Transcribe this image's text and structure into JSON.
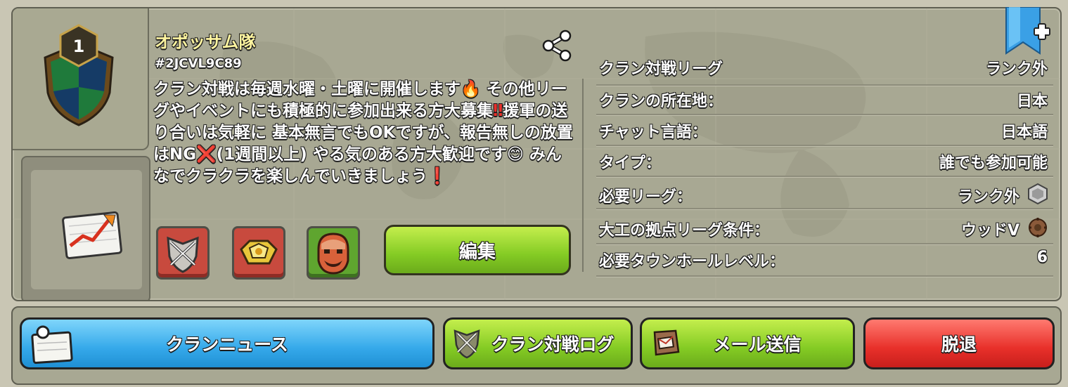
{
  "clan": {
    "name": "オポッサム隊",
    "tag": "#2JCVL9C89",
    "level": "1",
    "description": [
      {
        "text": "クラン対戦は毎週水曜・土曜に開催します",
        "emoji": "🔥"
      },
      {
        "text": " その他リーグやイベントにも積極的に参加出来る方大募集",
        "emoji": "‼"
      },
      {
        "text": "援軍の送り合いは気軽に 基本無言でもOKですが、報告無しの放置はNG",
        "emoji": "❌"
      },
      {
        "text": "(1週間以上) やる気のある方大歓迎です",
        "emoji": "😊"
      },
      {
        "text": " みんなでクラクラを楽しんでいきましょう",
        "emoji": "❗"
      }
    ]
  },
  "info_rows": [
    {
      "label": "クラン対戦リーグ",
      "value": "ランク外",
      "icon": ""
    },
    {
      "label": "クランの所在地：",
      "value": "日本",
      "icon": ""
    },
    {
      "label": "チャット言語：",
      "value": "日本語",
      "icon": ""
    },
    {
      "label": "タイプ：",
      "value": "誰でも参加可能",
      "icon": ""
    },
    {
      "label": "必要リーグ：",
      "value": "ランク外",
      "icon": "unranked-league-icon"
    },
    {
      "label": "大工の拠点リーグ条件：",
      "value": "ウッドV",
      "icon": "wood-league-icon"
    },
    {
      "label": "必要タウンホールレベル：",
      "value": "6",
      "icon": ""
    }
  ],
  "buttons": {
    "edit": "編集",
    "news": "クランニュース",
    "war_log": "クラン対戦ログ",
    "send_mail": "メール送信",
    "leave": "脱退"
  },
  "colors": {
    "panel": "#a8a893",
    "green_button": "#84cb24",
    "blue_button": "#35a9ea",
    "red_button": "#e8302a",
    "clan_name": "#fff5a0"
  }
}
